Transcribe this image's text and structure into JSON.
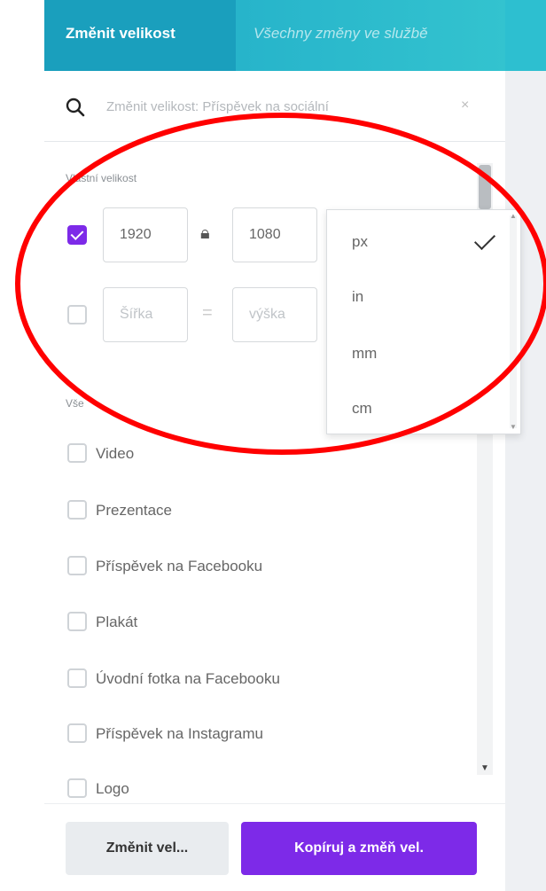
{
  "header": {
    "tab_active": "Změnit velikost",
    "tab_inactive": "Všechny změny ve službě"
  },
  "search": {
    "placeholder": "Změnit velikost: Příspěvek na sociální"
  },
  "custom_size": {
    "label": "Vlastní velikost",
    "row1": {
      "checked": true,
      "width": "1920",
      "height": "1080"
    },
    "row2": {
      "checked": false,
      "width_placeholder": "Šířka",
      "height_placeholder": "výška"
    }
  },
  "units": {
    "options": [
      "px",
      "in",
      "mm",
      "cm"
    ],
    "selected": "px"
  },
  "list": {
    "section_label": "Vše",
    "items": [
      "Video",
      "Prezentace",
      "Příspěvek na Facebooku",
      "Plakát",
      "Úvodní fotka na Facebooku",
      "Příspěvek na Instagramu",
      "Logo"
    ]
  },
  "footer": {
    "resize_label": "Změnit vel...",
    "copy_resize_label": "Kopíruj a změň vel."
  },
  "colors": {
    "header": "#1ea9c7",
    "accent": "#7d2ae8",
    "highlight": "#ff0000"
  }
}
